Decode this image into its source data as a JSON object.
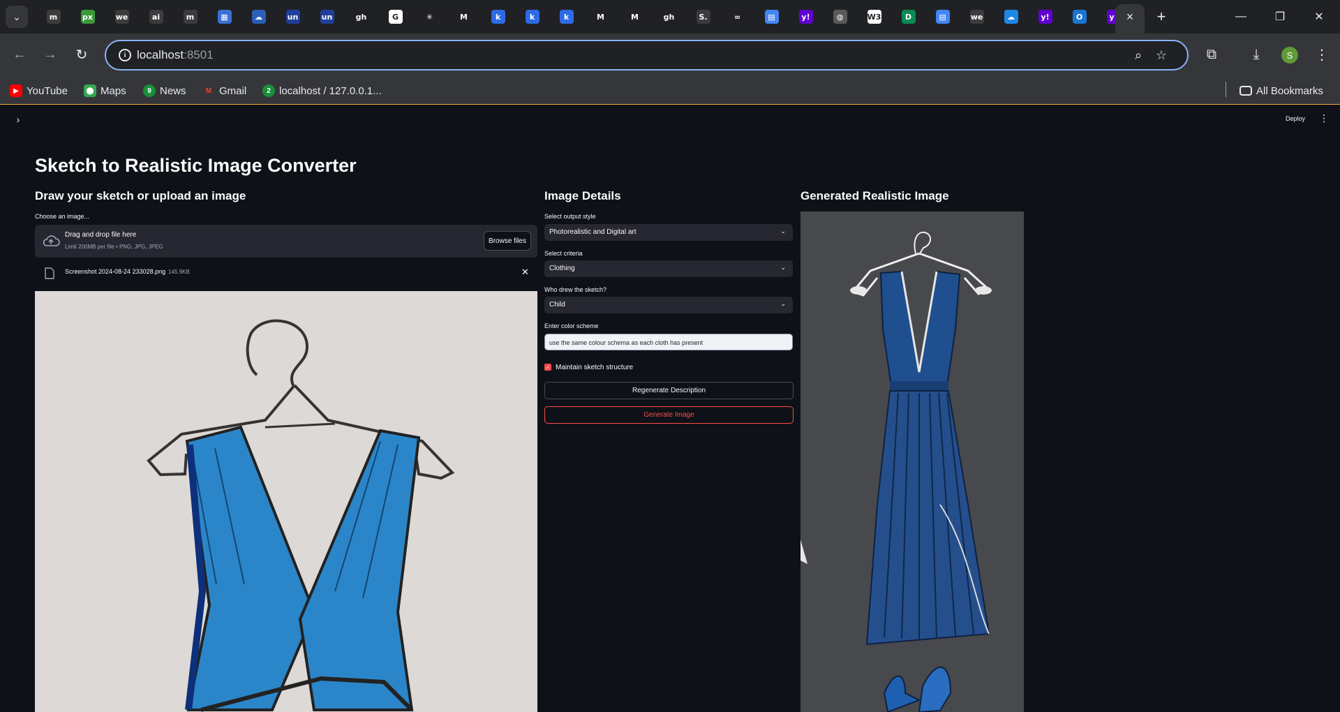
{
  "browser": {
    "tab_menu_icon": "chevron-down-icon",
    "tabs": [
      {
        "icon": "m",
        "color": "#3c3c3c"
      },
      {
        "icon": "px",
        "color": "#3a9a3a"
      },
      {
        "icon": "we",
        "color": "#3c3c3c"
      },
      {
        "icon": "ai",
        "color": "#3c3c3c"
      },
      {
        "icon": "m",
        "color": "#3c3c3c"
      },
      {
        "icon": "▦",
        "color": "#3b6fd4"
      },
      {
        "icon": "☁",
        "color": "#2b5fb8"
      },
      {
        "icon": "un",
        "color": "#1f3f9a"
      },
      {
        "icon": "un",
        "color": "#1f3f9a"
      },
      {
        "icon": "gh",
        "color": "#202124"
      },
      {
        "icon": "G",
        "color": "#ffffff"
      },
      {
        "icon": "✳",
        "color": "#202124"
      },
      {
        "icon": "M",
        "color": "#202124"
      },
      {
        "icon": "k",
        "color": "#2d6ae3"
      },
      {
        "icon": "k",
        "color": "#2d6ae3"
      },
      {
        "icon": "k",
        "color": "#2d6ae3"
      },
      {
        "icon": "M",
        "color": "#202124"
      },
      {
        "icon": "M",
        "color": "#202124"
      },
      {
        "icon": "gh",
        "color": "#202124"
      },
      {
        "icon": "S.",
        "color": "#3b3b3b"
      },
      {
        "icon": "∞",
        "color": "#202124"
      },
      {
        "icon": "▤",
        "color": "#4285f4"
      },
      {
        "icon": "y!",
        "color": "#6001d2"
      },
      {
        "icon": "◍",
        "color": "#5a5a5a"
      },
      {
        "icon": "W3",
        "color": "#ffffff"
      },
      {
        "icon": "D",
        "color": "#0a8a55"
      },
      {
        "icon": "▤",
        "color": "#4285f4"
      },
      {
        "icon": "we",
        "color": "#3c3c3c"
      },
      {
        "icon": "☁",
        "color": "#1e88e5"
      },
      {
        "icon": "y!",
        "color": "#6001d2"
      },
      {
        "icon": "O",
        "color": "#1976d2"
      },
      {
        "icon": "y!",
        "color": "#6001d2"
      }
    ],
    "active_tab_close": "×",
    "new_tab": "+",
    "url_host": "localhost",
    "url_port": ":8501",
    "profile_initial": "S",
    "bookmarks": [
      {
        "label": "YouTube",
        "icon": "▶",
        "color": "#ff0000"
      },
      {
        "label": "Maps",
        "icon": "⬤",
        "color": "#34a853"
      },
      {
        "label": "News",
        "icon": "9",
        "color": "#1a8f3a"
      },
      {
        "label": "Gmail",
        "icon": "M",
        "color": "#ea4335"
      },
      {
        "label": "localhost / 127.0.0.1...",
        "icon": "2",
        "color": "#1a8f3a"
      }
    ],
    "all_bookmarks": "All Bookmarks"
  },
  "app": {
    "deploy_label": "Deploy",
    "title": "Sketch to Realistic Image Converter",
    "left": {
      "heading": "Draw your sketch or upload an image",
      "upload_label": "Choose an image...",
      "dropzone_main": "Drag and drop file here",
      "dropzone_sub": "Limit 200MB per file • PNG, JPG, JPEG",
      "browse_label": "Browse files",
      "file_name": "Screenshot 2024-08-24 233028.png",
      "file_size": "145.9KB"
    },
    "middle": {
      "heading": "Image Details",
      "output_style_label": "Select output style",
      "output_style_value": "Photorealistic and Digital art",
      "criteria_label": "Select criteria",
      "criteria_value": "Clothing",
      "who_label": "Who drew the sketch?",
      "who_value": "Child",
      "color_label": "Enter color scheme",
      "color_value": "use the same colour schema as each cloth has present",
      "maintain_label": "Maintain sketch structure",
      "maintain_checked": true,
      "regen_label": "Regenerate Description",
      "generate_label": "Generate Image"
    },
    "right": {
      "heading": "Generated Realistic Image"
    }
  },
  "colors": {
    "accent": "#ff4b4b",
    "background": "#0e1117",
    "widget_bg": "#262730"
  }
}
